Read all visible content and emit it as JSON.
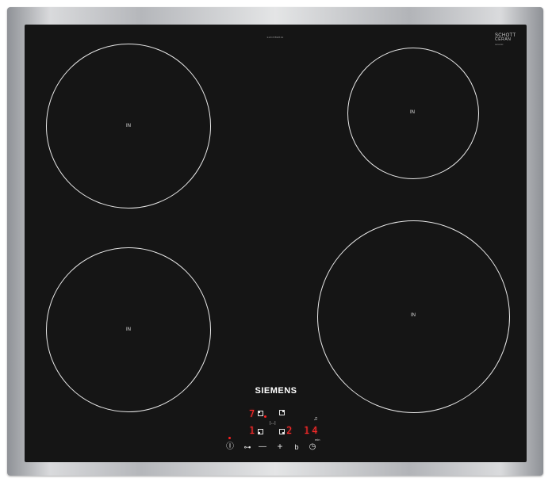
{
  "hob": {
    "model_text": "EH645BEB1E",
    "brand": "SIEMENS",
    "glass_logo": {
      "line1": "SCHOTT",
      "line2": "CERAN",
      "line3": "ceramic"
    },
    "zones": [
      {
        "id": "front-left-rear",
        "label": "IN"
      },
      {
        "id": "rear-right",
        "label": "IN"
      },
      {
        "id": "front-left",
        "label": "IN"
      },
      {
        "id": "front-right",
        "label": "IN"
      }
    ],
    "display": {
      "zone1_level": "7",
      "zone3_level": "1",
      "zone4_level": "2",
      "timer_value": "14",
      "timer_unit": "min",
      "transfer_symbol": "|↔|"
    },
    "controls": {
      "power": "Ⓘ",
      "lock": "⊶",
      "minus": "—",
      "plus": "+",
      "boost": "b",
      "timer": "◷",
      "bell": "♫"
    }
  }
}
